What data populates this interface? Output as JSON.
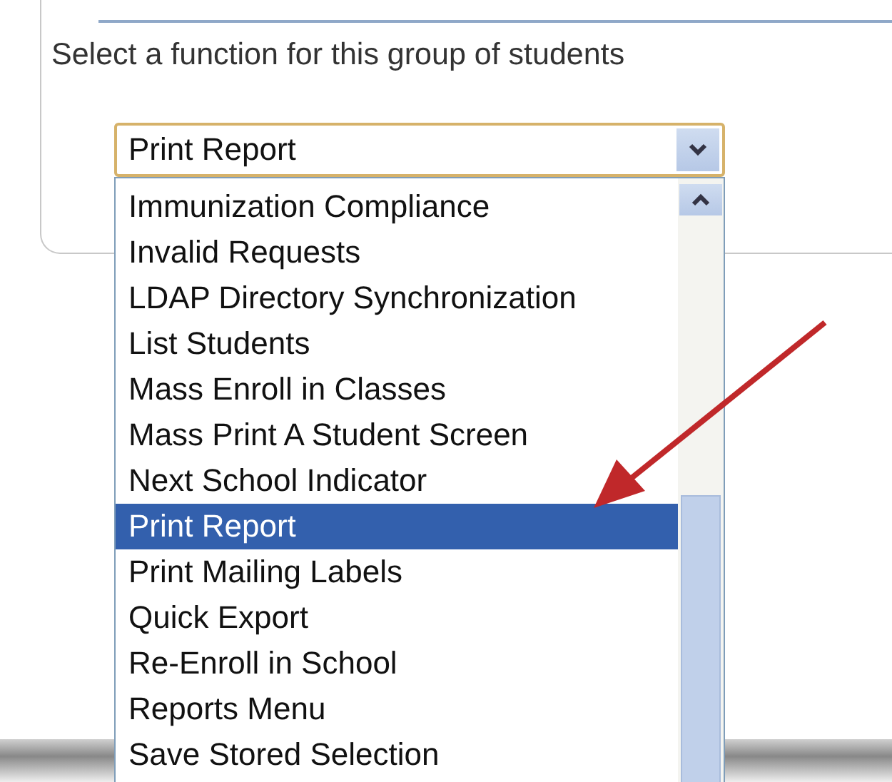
{
  "prompt": "Select a function for this group of students",
  "function_select": {
    "value": "Print Report"
  },
  "options": [
    {
      "label": "Immunization Compliance",
      "selected": false
    },
    {
      "label": "Invalid Requests",
      "selected": false
    },
    {
      "label": "LDAP Directory Synchronization",
      "selected": false
    },
    {
      "label": "List Students",
      "selected": false
    },
    {
      "label": "Mass Enroll in Classes",
      "selected": false
    },
    {
      "label": "Mass Print A Student Screen",
      "selected": false
    },
    {
      "label": "Next School Indicator",
      "selected": false
    },
    {
      "label": "Print Report",
      "selected": true
    },
    {
      "label": "Print Mailing Labels",
      "selected": false
    },
    {
      "label": "Quick Export",
      "selected": false
    },
    {
      "label": "Re-Enroll in School",
      "selected": false
    },
    {
      "label": "Reports Menu",
      "selected": false
    },
    {
      "label": "Save Stored Selection",
      "selected": false
    }
  ]
}
